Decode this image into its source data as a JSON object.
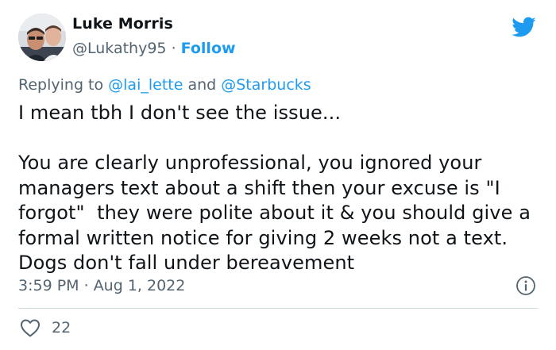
{
  "author": {
    "display_name": "Luke Morris",
    "handle": "@Lukathy95",
    "separator": " · ",
    "follow_label": "Follow"
  },
  "reply_context": {
    "prefix": "Replying to ",
    "mention_1": "@lai_lette",
    "conjunction": " and ",
    "mention_2": "@Starbucks"
  },
  "tweet": {
    "text": "I mean tbh I don't see the issue...\n\nYou are clearly unprofessional, you ignored your managers text about a shift then your excuse is \"I forgot\"  they were polite about it & you should give a formal written notice for giving 2 weeks not a text. Dogs don't fall under bereavement"
  },
  "meta": {
    "time": "3:59 PM",
    "separator": " · ",
    "date": "Aug 1, 2022"
  },
  "engagement": {
    "likes": "22"
  },
  "icons": {
    "brand": "twitter-bird-icon",
    "info": "info-icon",
    "like": "heart-icon"
  },
  "colors": {
    "brand_blue": "#1d9bf0",
    "text_primary": "#0f1419",
    "text_secondary": "#536471",
    "divider": "#cfd9de"
  }
}
